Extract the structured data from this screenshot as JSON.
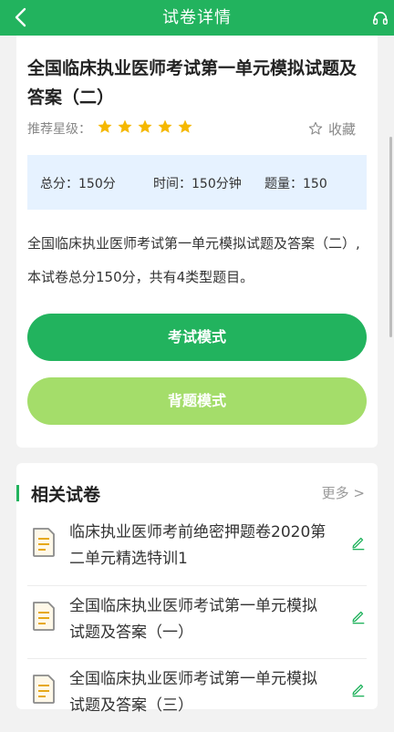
{
  "header": {
    "title": "试卷详情"
  },
  "exam": {
    "title": "全国临床执业医师考试第一单元模拟试题及答案（二）",
    "rating_label": "推荐星级：",
    "rating": 5,
    "favorite_label": "收藏",
    "total_score": "总分：150分",
    "time": "时间：150分钟",
    "question_count": "题量：150",
    "description": "全国临床执业医师考试第一单元模拟试题及答案（二）,本试卷总分150分，共有4类型题目。"
  },
  "buttons": {
    "exam_mode": "考试模式",
    "recite_mode": "背题模式"
  },
  "related": {
    "title": "相关试卷",
    "more": "更多 >",
    "papers": [
      {
        "name": "临床执业医师考前绝密押题卷2020第二单元精选特训1"
      },
      {
        "name": "全国临床执业医师考试第一单元模拟试题及答案（一）"
      },
      {
        "name": "全国临床执业医师考试第一单元模拟试题及答案（三）"
      }
    ]
  },
  "colors": {
    "primary_green": "#22b35e",
    "light_green": "#a4dd6a",
    "star_yellow": "#f5b800",
    "info_bg": "#e6f2ff"
  }
}
